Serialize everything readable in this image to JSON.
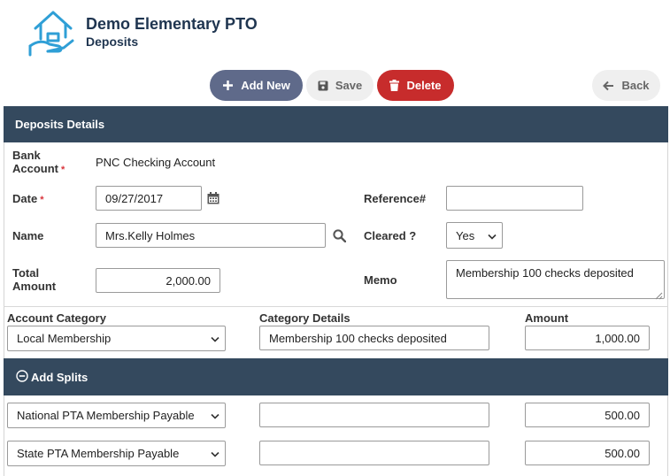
{
  "header": {
    "org_name": "Demo Elementary PTO",
    "page_name": "Deposits",
    "logo_icon": "house-hand-icon"
  },
  "toolbar": {
    "add_new_label": "Add New",
    "save_label": "Save",
    "delete_label": "Delete",
    "back_label": "Back"
  },
  "details": {
    "section_title": "Deposits Details",
    "bank_account_label_line1": "Bank",
    "bank_account_label_line2": "Account",
    "bank_account_value": "PNC Checking Account",
    "date_label": "Date",
    "date_value": "09/27/2017",
    "name_label": "Name",
    "name_value": "Mrs.Kelly Holmes",
    "total_amount_label_line1": "Total",
    "total_amount_label_line2": "Amount",
    "total_amount_value": "2,000.00",
    "reference_label": "Reference#",
    "reference_value": "",
    "cleared_label": "Cleared ?",
    "cleared_value": "Yes",
    "memo_label": "Memo",
    "memo_value": "Membership 100 checks deposited",
    "required_marker": "*"
  },
  "category": {
    "account_category_header": "Account Category",
    "category_details_header": "Category Details",
    "amount_header": "Amount",
    "account_category_value": "Local Membership",
    "category_details_value": "Membership 100 checks deposited",
    "amount_value": "1,000.00"
  },
  "splits": {
    "section_title": "Add Splits",
    "rows": [
      {
        "account": "National PTA Membership Payable",
        "details": "",
        "amount": "500.00"
      },
      {
        "account": "State PTA Membership Payable",
        "details": "",
        "amount": "500.00"
      }
    ]
  },
  "colors": {
    "header_bar": "#34495e",
    "add_new_button": "#5f6a8a",
    "delete_button": "#c72c2c",
    "title_text": "#1f3550",
    "required": "#d9343b"
  }
}
